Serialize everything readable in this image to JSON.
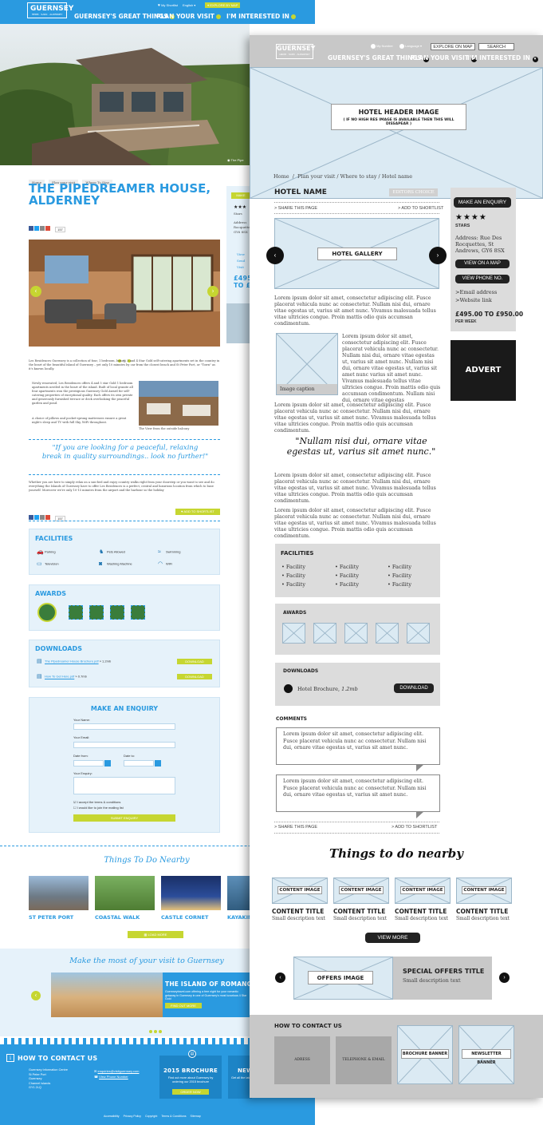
{
  "left": {
    "logo": {
      "name": "GUERNSEY",
      "tagline": "HERM · SARK · ALDERNEY"
    },
    "topbar": {
      "shortlist": "My Shortlist",
      "language": "English",
      "explore": "EXPLORE BY MAP"
    },
    "nav": [
      "GUERNSEY'S GREAT THINGS",
      "PLAN YOUR VISIT",
      "I'M INTERESTED IN"
    ],
    "hero_caption": "The Pipe",
    "breadcrumb": [
      "Home",
      "Plan your visit",
      "Where To Stay"
    ],
    "title": [
      "THE PIPEDREAMER HOUSE,",
      "ALDERNEY"
    ],
    "share_count": "157",
    "sidebar": {
      "enquiry": "MAKE",
      "stars": "Stars",
      "address": [
        "Address",
        "Rocquettes",
        "GY6 8SX"
      ],
      "links": [
        "View",
        "Send",
        "Visit"
      ],
      "price": [
        "£495",
        "TO £"
      ]
    },
    "intro": "Les Residences Guernsey is a collection of four, 1 bedroom, luxury, 3 and 4 Star Gold self-catering apartments set in the country in the heart of the beautiful island of Guernsey – yet only 10 minutes by car from the closest beach and St Peter Port, or \"Town\" as it's known locally.",
    "body1": "Newly renovated, Les Residences offers 4 and 5 star Gold 1 bedroom apartments nestled in the heart of the island. Built of local granite all four apartments won the prestigious Guernsey Gold Award for self-catering properties of exceptional quality. Each offers its own private and generously furnished terrace or deck overlooking the peaceful garden and pond.",
    "body2": "A choice of pillows and pocket-sprung mattresses ensure a great night's sleep and TV with full Sky, WiFi throughout.",
    "image_caption": "The View from the outside balcony",
    "quote": "\"If you are looking for a peaceful, relaxing break in quality surroundings.. look no further!\"",
    "body3": "Whether you are here to simply relax on a sun-bed and enjoy country walks right from your doorstep or you want to see and do everything the Islands of Guernsey have to offer Les Residences is a perfect, central and luxurious location from which to base yourself. Moreover we're only 10-15 minutes from the airport and the harbour so the holiday",
    "shortlist_btn": "ADD TO SHORTLIST",
    "facilities_title": "FACILITIES",
    "facilities": [
      {
        "label": "Parking",
        "icon": "car-icon"
      },
      {
        "label": "Pets Allowed",
        "icon": "pet-icon"
      },
      {
        "label": "Swimming",
        "icon": "swimming-icon"
      },
      {
        "label": "Television",
        "icon": "tv-icon"
      },
      {
        "label": "Washing Machine",
        "icon": "washing-machine-icon"
      },
      {
        "label": "WiFi",
        "icon": "wifi-icon"
      }
    ],
    "awards_title": "AWARDS",
    "downloads_title": "DOWNLOADS",
    "downloads": [
      {
        "name": "The Pipedreamer House Brochure.pdf",
        "size": "1.2mb",
        "btn": "DOWNLOAD"
      },
      {
        "name": "How To Get Here.pdf",
        "size": "0.7mb",
        "btn": "DOWNLOAD"
      }
    ],
    "enquiry": {
      "title": "MAKE AN ENQUIRY",
      "name": "Your Name:",
      "email": "Your Email:",
      "from": "Date from:",
      "to": "Date to:",
      "message": "Your Enquiry:",
      "terms": "I accept the terms & conditions",
      "mailing": "I would like to join the mailing list",
      "submit": "SUBMIT ENQUIRY"
    },
    "things_title": "Things To Do Nearby",
    "things": [
      "ST PETER PORT",
      "COASTAL WALK",
      "CASTLE CORNET",
      "KAYAKIN"
    ],
    "load_more": "LOAD MORE",
    "make_most": "Make the most of your visit to Guernsey",
    "promo": {
      "title": "THE ISLAND OF ROMANCE",
      "text": "Guernseytravel.com offering a free night for your romantic getaway in Guernsey in one of Guernsey's most luxurious 4 Star Gold",
      "btn": "FIND OUT MORE"
    },
    "contact": {
      "title": "HOW TO CONTACT US",
      "address": [
        "Guernsey Information Centre",
        "St Peter Port",
        "Guernsey",
        "Channel Islands",
        "GY1 2LQ"
      ],
      "email": "enquiries@visitguernsey.com",
      "phone": "View Phone Number",
      "brochure_title": "2015 BROCHURE",
      "brochure_text": "Find out more about Guernsey by ordering our 2015 brochure",
      "brochure_btn": "ORDER NOW",
      "news": "NEW",
      "news_text": "Get all the latest offers"
    },
    "footer": [
      "Accessibility",
      "Privacy Policy",
      "Copyright",
      "Terms & Conditions",
      "Sitemap"
    ]
  },
  "right": {
    "logo": {
      "name": "GUERNSEY",
      "tagline": "HERM · SARK · ALDERNEY"
    },
    "top": {
      "my_number": "My Number",
      "language": "Language",
      "explore": "EXPLORE ON MAP",
      "search": "SEARCH"
    },
    "nav": [
      "GUERNSEY'S GREAT THINGS",
      "PLAN YOUR VISIT",
      "I'M INTERESTED IN"
    ],
    "header_image": "HOTEL HEADER IMAGE",
    "header_note": "( IF NO HIGH RES IMAGE IS AVAILABLE THEN THIS WILL DISSAPEAR )",
    "breadcrumb": "Home  /  Plan your visit / Where to stay / Hotel name",
    "hotel_name": "HOTEL NAME",
    "editors_choice": "EDITORS CHOICE",
    "share": "> SHARE THIS PAGE",
    "shortlist": "> ADD TO SHORTLIST",
    "gallery": "HOTEL GALLERY",
    "lorem_short": "Lorem ipsum dolor sit amet, consectetur adipiscing elit. Fusce placerat vehicula nunc ac consectetur. Nullam nisi dui, ornare vitae egestas ut, varius sit amet nunc. Vivamus malesuada tellus vitae ultricies congue. Proin mattis odio quis accumsan condimentum.",
    "lorem_wrap": "Lorem ipsum dolor sit amet, consectetur adipiscing elit. Fusce placerat vehicula nunc ac consectetur. Nullam nisi dui, ornare vitae egestas ut, varius sit amet nunc. Nullam nisi dui, ornare vitae egestas ut, varius sit amet nunc varius sit amet nunc. Vivamus malesuada tellus vitae ultricies congue. Proin mattis odio quis accumsan condimentum. Nullam nisi dui, ornare vitae egestas",
    "image_caption": "Image caption",
    "quote": "\"Nullam nisi dui, ornare vitae egestas ut, varius sit amet nunc.\"",
    "sidebar": {
      "enquiry": "MAKE AN ENQUIRY",
      "stars_label": "STARS",
      "address": "Address: Rue Des Rocquettes, St Andrews, GY6 8SX",
      "map": "VIEW ON A MAP",
      "phone": "VIEW PHONE NO.",
      "email": ">Email address",
      "website": ">Website link",
      "price": "£495.00 TO £950.00",
      "per_week": "PER WEEK"
    },
    "advert": "ADVERT",
    "facilities_title": "FACILITIES",
    "facility": "Facility",
    "awards_title": "AWARDS",
    "downloads_title": "DOWNLOADS",
    "brochure": "Hotel Brochure,",
    "brochure_size": "1.2mb",
    "download_btn": "DOWNLOAD",
    "comments_title": "COMMENTS",
    "comment": "Lorem ipsum dolor sit amet, consectetur adipiscing elit. Fusce placerat vehicula nunc ac consectetur. Nullam nisi dui, ornare vitae egestas ut, varius sit amet nunc.",
    "things_title": "Things to do nearby",
    "content_image": "CONTENT IMAGE",
    "content_title": "CONTENT TITLE",
    "content_sub": "Small description text",
    "view_more": "VIEW MORE",
    "offers_image": "OFFERS IMAGE",
    "offers_title": "SPECIAL OFFERS TITLE",
    "offers_sub": "Small description text",
    "contact_title": "HOW TO CONTACT US",
    "address_box": "ADRESS",
    "telephone_box": "TELEPHONE & EMAIL",
    "brochure_banner": "BROCHURE BANNER",
    "newsletter_banner": "NEWSLETTER BANNER"
  }
}
